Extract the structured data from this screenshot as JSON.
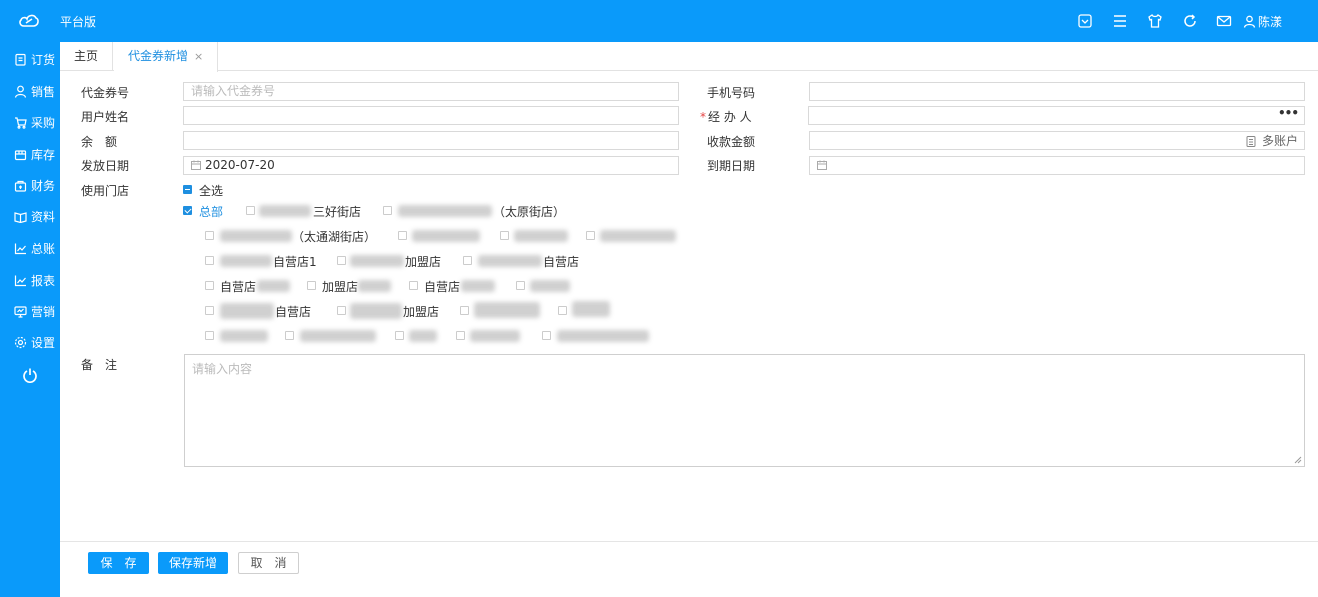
{
  "app": {
    "brand": "平台版",
    "user": "陈漾"
  },
  "sidebar": {
    "items": [
      {
        "label": "订货",
        "icon": "order-icon"
      },
      {
        "label": "销售",
        "icon": "user-icon"
      },
      {
        "label": "采购",
        "icon": "cart-icon"
      },
      {
        "label": "库存",
        "icon": "box-icon"
      },
      {
        "label": "财务",
        "icon": "finance-icon"
      },
      {
        "label": "资料",
        "icon": "book-icon"
      },
      {
        "label": "总账",
        "icon": "chart-icon"
      },
      {
        "label": "报表",
        "icon": "report-icon"
      },
      {
        "label": "营销",
        "icon": "screen-icon"
      },
      {
        "label": "设置",
        "icon": "gear-icon"
      }
    ]
  },
  "tabs": {
    "home": "主页",
    "active": "代金券新增",
    "close": "×"
  },
  "form": {
    "voucher_no": {
      "label": "代金券号",
      "placeholder": "请输入代金券号"
    },
    "phone": {
      "label": "手机号码",
      "value": ""
    },
    "user_name": {
      "label": "用户姓名",
      "value": ""
    },
    "handler": {
      "label": "经 办 人",
      "required_mark": "*",
      "more": "•••"
    },
    "balance": {
      "label": "余　额",
      "value": ""
    },
    "received": {
      "label": "收款金额",
      "multi_account": "多账户"
    },
    "issue_date": {
      "label": "发放日期",
      "value": "2020-07-20"
    },
    "expire_date": {
      "label": "到期日期",
      "value": ""
    },
    "stores": {
      "label": "使用门店",
      "select_all": "全选",
      "hq": "总部",
      "names": {
        "s1": "三好街店",
        "s2": "（太原街店）",
        "s3": "（太通湖街店）",
        "s4": "自营店1",
        "s5": "加盟店",
        "s6": "自营店",
        "s7": "自营店",
        "s8": "加盟店",
        "s9": "自营店",
        "s10": "自营店",
        "s11": "加盟店"
      }
    },
    "remark": {
      "label": "备　注",
      "placeholder": "请输入内容"
    }
  },
  "buttons": {
    "save": "保　存",
    "save_new": "保存新增",
    "cancel": "取　消"
  },
  "colors": {
    "primary": "#0a9afa",
    "link": "#1e8fe0",
    "required": "#e64545"
  }
}
